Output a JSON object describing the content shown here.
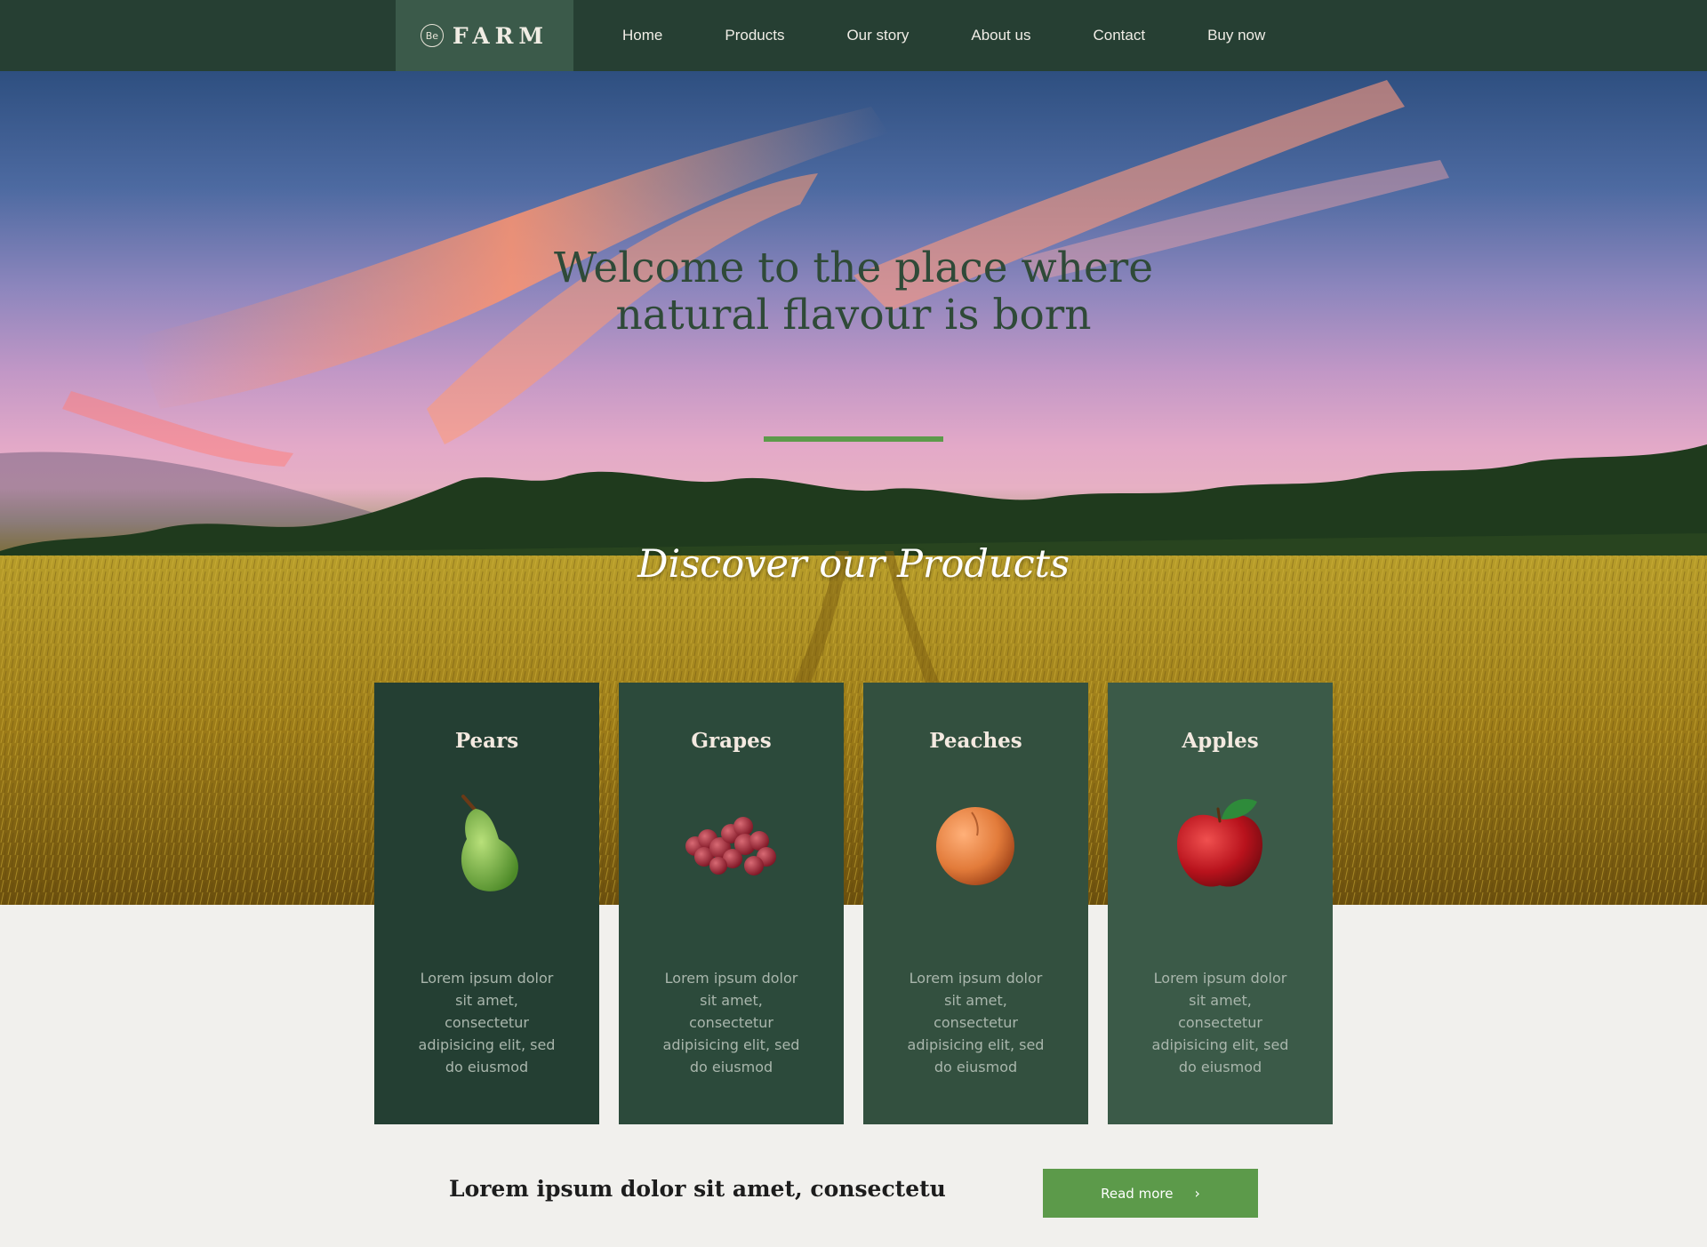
{
  "nav": {
    "logo_badge": "Be",
    "logo_text": "FARM",
    "links": [
      "Home",
      "Products",
      "Our story",
      "About us",
      "Contact",
      "Buy now"
    ]
  },
  "hero": {
    "title": "Welcome to the place where natural flavour is born",
    "subtitle": "Discover our Products",
    "accent_color": "#5c9a4a"
  },
  "products": [
    {
      "name": "Pears",
      "icon": "pear-icon",
      "description": "Lorem ipsum dolor sit amet, consectetur adipisicing elit, sed do eiusmod"
    },
    {
      "name": "Grapes",
      "icon": "grapes-icon",
      "description": "Lorem ipsum dolor sit amet, consectetur adipisicing elit, sed do eiusmod"
    },
    {
      "name": "Peaches",
      "icon": "peach-icon",
      "description": "Lorem ipsum dolor sit amet, consectetur adipisicing elit, sed do eiusmod"
    },
    {
      "name": "Apples",
      "icon": "apple-icon",
      "description": "Lorem ipsum dolor sit amet, consectetur adipisicing elit, sed do eiusmod"
    }
  ],
  "card_colors": [
    "#243f33",
    "#2c4a3b",
    "#33503f",
    "#3b5a48"
  ],
  "bottom": {
    "text": "Lorem ipsum dolor sit amet, consectetu",
    "button_label": "Read more",
    "button_chevron": "›"
  }
}
